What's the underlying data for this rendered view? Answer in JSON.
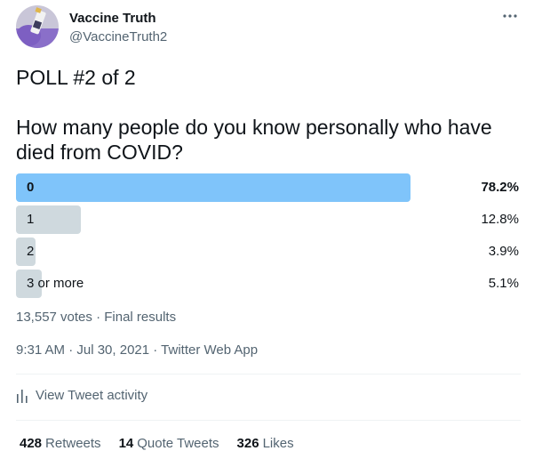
{
  "author": {
    "name": "Vaccine Truth",
    "handle": "@VaccineTruth2"
  },
  "tweet": {
    "line1": "POLL #2 of 2",
    "question": "How many people do you know personally who have died from COVID?"
  },
  "poll": {
    "options": [
      {
        "label": "0",
        "percent": "78.2%",
        "fraction": 0.782,
        "winner": true
      },
      {
        "label": "1",
        "percent": "12.8%",
        "fraction": 0.128,
        "winner": false
      },
      {
        "label": "2",
        "percent": "3.9%",
        "fraction": 0.039,
        "winner": false
      },
      {
        "label": "3 or more",
        "percent": "5.1%",
        "fraction": 0.051,
        "winner": false
      }
    ],
    "summary": "13,557 votes · Final results"
  },
  "meta": {
    "time": "9:31 AM · Jul 30, 2021",
    "separator": " · ",
    "source": "Twitter Web App"
  },
  "activity": {
    "label": "View Tweet activity"
  },
  "stats": {
    "retweets_count": "428",
    "retweets_label": "Retweets",
    "quotes_count": "14",
    "quotes_label": "Quote Tweets",
    "likes_count": "326",
    "likes_label": "Likes"
  },
  "colors": {
    "winner_bar": "#7fc4fa",
    "other_bar": "#cfd9de",
    "secondary_text": "#536471"
  },
  "icons": {
    "more": "more-dots-icon",
    "activity": "bar-chart-icon"
  }
}
